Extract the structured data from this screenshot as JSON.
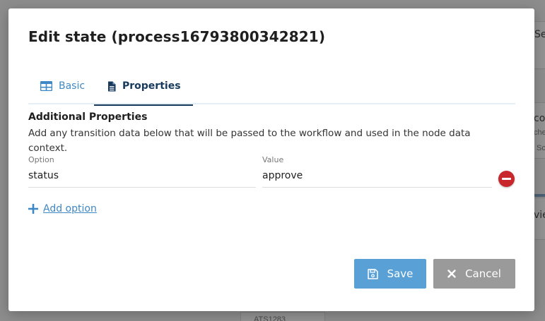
{
  "modal": {
    "title": "Edit state (process16793800342821)"
  },
  "tabs": [
    {
      "label": "Basic",
      "icon": "table-icon",
      "active": false
    },
    {
      "label": "Properties",
      "icon": "document-icon",
      "active": true
    }
  ],
  "properties": {
    "title": "Additional Properties",
    "description": "Add any transition data below that will be passed to the workflow and used in the node data context.",
    "option_label": "Option",
    "value_label": "Value",
    "rows": [
      {
        "option": "status",
        "value": "approve"
      }
    ],
    "add_option_label": "Add option"
  },
  "footer": {
    "save_label": "Save",
    "cancel_label": "Cancel"
  },
  "background": {
    "fragments": [
      "Ser",
      "con",
      "che",
      "Sc",
      "vie",
      "ATS1283"
    ]
  },
  "colors": {
    "accent": "#3f88c5",
    "tab_active": "#16395c",
    "save": "#58a0d6",
    "cancel": "#9a9a9a",
    "remove": "#c8282c"
  }
}
